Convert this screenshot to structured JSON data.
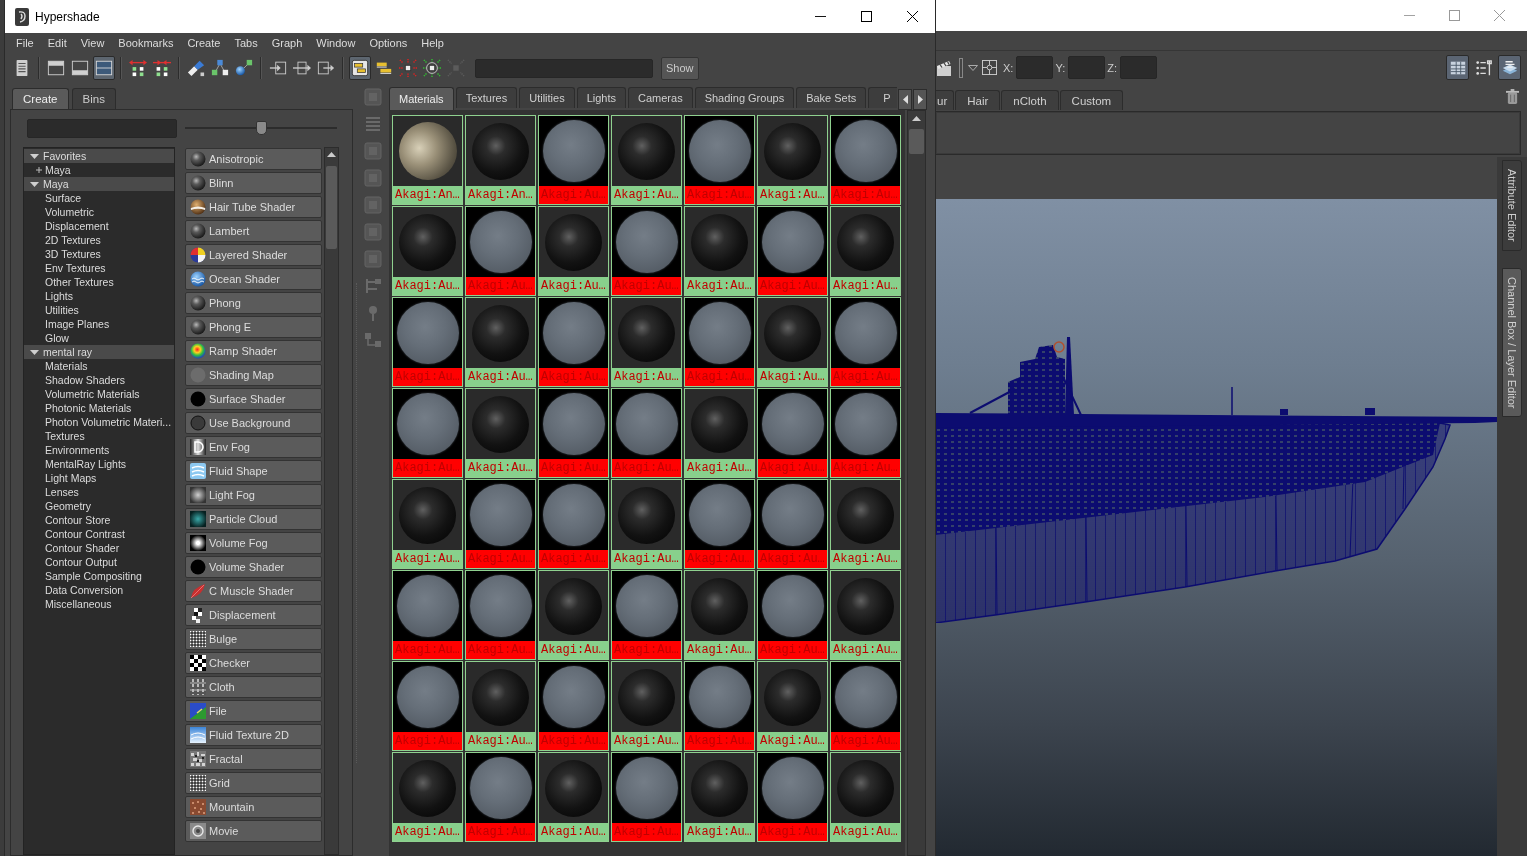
{
  "hypershade": {
    "title": "Hypershade",
    "menu": [
      "File",
      "Edit",
      "View",
      "Bookmarks",
      "Create",
      "Tabs",
      "Graph",
      "Window",
      "Options",
      "Help"
    ],
    "toolbar": [
      {
        "on": false,
        "disabled": false
      },
      {
        "on": false,
        "disabled": false
      },
      {
        "on": false,
        "disabled": false
      },
      {
        "on": true,
        "disabled": false
      },
      {
        "on": false,
        "disabled": false
      },
      {
        "on": false,
        "disabled": false
      },
      {
        "on": false,
        "disabled": false
      },
      {
        "on": false,
        "disabled": false
      },
      {
        "on": false,
        "disabled": false
      },
      {
        "on": false,
        "disabled": false
      },
      {
        "on": false,
        "disabled": false
      },
      {
        "on": false,
        "disabled": false
      },
      {
        "on": true,
        "disabled": false
      },
      {
        "on": false,
        "disabled": false
      },
      {
        "on": false,
        "disabled": false
      },
      {
        "on": false,
        "disabled": false
      },
      {
        "on": false,
        "disabled": true
      }
    ],
    "show_button": "Show",
    "create_panel": {
      "tabs": [
        {
          "label": "Create",
          "selected": true
        },
        {
          "label": "Bins",
          "selected": false
        }
      ],
      "slider": {
        "level": 0.5
      },
      "tree": [
        {
          "label": "Favorites",
          "expanded": true,
          "children": [
            {
              "label": "Maya",
              "expanded": false
            }
          ]
        },
        {
          "label": "Maya",
          "expanded": true,
          "children": [
            {
              "label": "Surface"
            },
            {
              "label": "Volumetric"
            },
            {
              "label": "Displacement"
            },
            {
              "label": "2D Textures"
            },
            {
              "label": "3D Textures"
            },
            {
              "label": "Env Textures"
            },
            {
              "label": "Other Textures"
            },
            {
              "label": "Lights"
            },
            {
              "label": "Utilities"
            },
            {
              "label": "Image Planes"
            },
            {
              "label": "Glow"
            }
          ]
        },
        {
          "label": "mental ray",
          "expanded": true,
          "children": [
            {
              "label": "Materials"
            },
            {
              "label": "Shadow Shaders"
            },
            {
              "label": "Volumetric Materials"
            },
            {
              "label": "Photonic Materials"
            },
            {
              "label": "Photon Volumetric Materi..."
            },
            {
              "label": "Textures"
            },
            {
              "label": "Environments"
            },
            {
              "label": "MentalRay Lights"
            },
            {
              "label": "Light Maps"
            },
            {
              "label": "Lenses"
            },
            {
              "label": "Geometry"
            },
            {
              "label": "Contour Store"
            },
            {
              "label": "Contour Contrast"
            },
            {
              "label": "Contour Shader"
            },
            {
              "label": "Contour Output"
            },
            {
              "label": "Sample Compositing"
            },
            {
              "label": "Data Conversion"
            },
            {
              "label": "Miscellaneous"
            }
          ]
        }
      ],
      "nodes": [
        "Anisotropic",
        "Blinn",
        "Hair Tube Shader",
        "Lambert",
        "Layered Shader",
        "Ocean Shader",
        "Phong",
        "Phong E",
        "Ramp Shader",
        "Shading Map",
        "Surface Shader",
        "Use Background",
        "Env Fog",
        "Fluid Shape",
        "Light Fog",
        "Particle Cloud",
        "Volume Fog",
        "Volume Shader",
        "C Muscle Shader",
        "Displacement",
        "Bulge",
        "Checker",
        "Cloth",
        "File",
        "Fluid Texture 2D",
        "Fractal",
        "Grid",
        "Mountain",
        "Movie"
      ]
    },
    "side_toolbar": [
      {
        "disabled": true
      },
      {
        "disabled": true
      },
      {
        "disabled": true
      },
      {
        "disabled": true
      },
      {
        "disabled": true
      },
      {
        "disabled": true
      },
      {
        "disabled": true
      },
      {
        "disabled": true
      },
      {
        "disabled": true
      },
      {
        "disabled": true
      }
    ],
    "browser": {
      "tabs": [
        {
          "label": "Materials",
          "selected": true
        },
        {
          "label": "Textures",
          "selected": false
        },
        {
          "label": "Utilities",
          "selected": false
        },
        {
          "label": "Lights",
          "selected": false
        },
        {
          "label": "Cameras",
          "selected": false
        },
        {
          "label": "Shading Groups",
          "selected": false
        },
        {
          "label": "Bake Sets",
          "selected": false
        },
        {
          "label": "P",
          "selected": false
        }
      ],
      "materials": [
        {
          "label": "Akagi:An…",
          "kind": "textured",
          "color": "#88d08c"
        },
        {
          "label": "Akagi:An…",
          "kind": "glossy",
          "color": "#88d08c"
        },
        {
          "label": "Akagi:Au…",
          "kind": "matte",
          "color": "#ff0000"
        },
        {
          "label": "Akagi:Au…",
          "kind": "glossy",
          "color": "#88d08c"
        },
        {
          "label": "Akagi:Au…",
          "kind": "matte",
          "color": "#ff0000"
        },
        {
          "label": "Akagi:Au…",
          "kind": "glossy",
          "color": "#88d08c"
        },
        {
          "label": "Akagi:Au…",
          "kind": "matte",
          "color": "#ff0000"
        },
        {
          "label": "Akagi:Au…",
          "kind": "glossy",
          "color": "#88d08c"
        },
        {
          "label": "Akagi:Au…",
          "kind": "matte",
          "color": "#ff0000"
        },
        {
          "label": "Akagi:Au…",
          "kind": "glossy",
          "color": "#88d08c"
        },
        {
          "label": "Akagi:Au…",
          "kind": "matte",
          "color": "#ff0000"
        },
        {
          "label": "Akagi:Au…",
          "kind": "glossy",
          "color": "#88d08c"
        },
        {
          "label": "Akagi:Au…",
          "kind": "matte",
          "color": "#ff0000"
        },
        {
          "label": "Akagi:Au…",
          "kind": "glossy",
          "color": "#88d08c"
        },
        {
          "label": "Akagi:Au…",
          "kind": "matte",
          "color": "#ff0000"
        },
        {
          "label": "Akagi:Au…",
          "kind": "glossy",
          "color": "#88d08c"
        },
        {
          "label": "Akagi:Au…",
          "kind": "matte",
          "color": "#ff0000"
        },
        {
          "label": "Akagi:Au…",
          "kind": "glossy",
          "color": "#88d08c"
        },
        {
          "label": "Akagi:Au…",
          "kind": "matte",
          "color": "#ff0000"
        },
        {
          "label": "Akagi:Au…",
          "kind": "glossy",
          "color": "#88d08c"
        },
        {
          "label": "Akagi:Au…",
          "kind": "matte",
          "color": "#ff0000"
        },
        {
          "label": "Akagi:Au…",
          "kind": "matte",
          "color": "#ff0000"
        },
        {
          "label": "Akagi:Au…",
          "kind": "glossy",
          "color": "#88d08c"
        },
        {
          "label": "Akagi:Au…",
          "kind": "matte",
          "color": "#ff0000"
        },
        {
          "label": "Akagi:Au…",
          "kind": "matte",
          "color": "#ff0000"
        },
        {
          "label": "Akagi:Au…",
          "kind": "glossy",
          "color": "#88d08c"
        },
        {
          "label": "Akagi:Au…",
          "kind": "matte",
          "color": "#ff0000"
        },
        {
          "label": "Akagi:Au…",
          "kind": "matte",
          "color": "#ff0000"
        },
        {
          "label": "Akagi:Au…",
          "kind": "glossy",
          "color": "#88d08c"
        },
        {
          "label": "Akagi:Au…",
          "kind": "matte",
          "color": "#ff0000"
        },
        {
          "label": "Akagi:Au…",
          "kind": "matte",
          "color": "#ff0000"
        },
        {
          "label": "Akagi:Au…",
          "kind": "glossy",
          "color": "#88d08c"
        },
        {
          "label": "Akagi:Au…",
          "kind": "matte",
          "color": "#ff0000"
        },
        {
          "label": "Akagi:Au…",
          "kind": "matte",
          "color": "#ff0000"
        },
        {
          "label": "Akagi:Au…",
          "kind": "glossy",
          "color": "#88d08c"
        },
        {
          "label": "Akagi:Au…",
          "kind": "matte",
          "color": "#ff0000"
        },
        {
          "label": "Akagi:Au…",
          "kind": "matte",
          "color": "#ff0000"
        },
        {
          "label": "Akagi:Au…",
          "kind": "glossy",
          "color": "#88d08c"
        },
        {
          "label": "Akagi:Au…",
          "kind": "matte",
          "color": "#ff0000"
        },
        {
          "label": "Akagi:Au…",
          "kind": "glossy",
          "color": "#88d08c"
        },
        {
          "label": "Akagi:Au…",
          "kind": "matte",
          "color": "#ff0000"
        },
        {
          "label": "Akagi:Au…",
          "kind": "glossy",
          "color": "#88d08c"
        },
        {
          "label": "Akagi:Au…",
          "kind": "matte",
          "color": "#ff0000"
        },
        {
          "label": "Akagi:Au…",
          "kind": "glossy",
          "color": "#88d08c"
        },
        {
          "label": "Akagi:Au…",
          "kind": "matte",
          "color": "#ff0000"
        },
        {
          "label": "Akagi:Au…",
          "kind": "glossy",
          "color": "#88d08c"
        },
        {
          "label": "Akagi:Au…",
          "kind": "matte",
          "color": "#ff0000"
        },
        {
          "label": "Akagi:Au…",
          "kind": "glossy",
          "color": "#88d08c"
        },
        {
          "label": "Akagi:Au…",
          "kind": "matte",
          "color": "#ff0000"
        },
        {
          "label": "Akagi:Au…",
          "kind": "glossy",
          "color": "#88d08c"
        },
        {
          "label": "Akagi:Au…",
          "kind": "matte",
          "color": "#ff0000"
        },
        {
          "label": "Akagi:Au…",
          "kind": "glossy",
          "color": "#88d08c"
        },
        {
          "label": "Akagi:Au…",
          "kind": "matte",
          "color": "#ff0000"
        },
        {
          "label": "Akagi:Au…",
          "kind": "glossy",
          "color": "#88d08c"
        },
        {
          "label": "Akagi:Au…",
          "kind": "matte",
          "color": "#ff0000"
        },
        {
          "label": "Akagi:Au…",
          "kind": "glossy",
          "color": "#88d08c"
        }
      ]
    }
  },
  "main_window": {
    "toolbar": {
      "fields": [
        {
          "label": "X:"
        },
        {
          "label": "Y:"
        },
        {
          "label": "Z:"
        }
      ],
      "panel_buttons": [
        {
          "on": true
        },
        {
          "on": false
        },
        {
          "on": true
        }
      ]
    },
    "shelf_tabs": [
      {
        "label": "ur",
        "selected": false
      },
      {
        "label": "Hair",
        "selected": false
      },
      {
        "label": "nCloth",
        "selected": false
      },
      {
        "label": "Custom",
        "selected": false
      }
    ],
    "side_tabs": [
      {
        "label": "Attribute Editor",
        "selected": false
      },
      {
        "label": "Channel Box / Layer Editor",
        "selected": true
      }
    ]
  }
}
